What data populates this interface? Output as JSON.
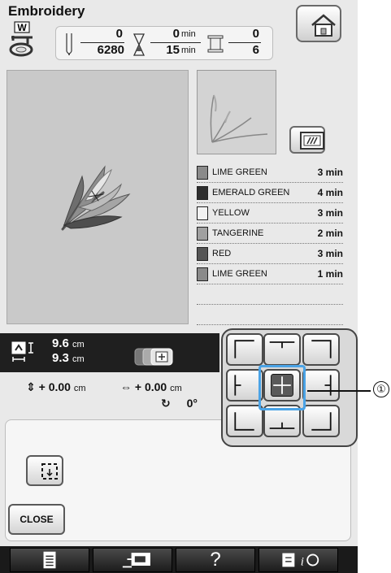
{
  "header": {
    "title": "Embroidery",
    "presser_foot_letter": "W",
    "stitch_current": "0",
    "stitch_total": "6280",
    "time_current": "0",
    "time_total": "15",
    "time_unit": "min",
    "color_current": "0",
    "color_total": "6"
  },
  "icons": {
    "home": "home-icon",
    "frame": "embroidery-frame-icon",
    "size": "size-icon",
    "multi_select": "multi-pattern-icon",
    "trial": "trial-frame-icon",
    "list": "list-icon",
    "sewing": "sewing-machine-icon",
    "help": "help-icon",
    "settings": "settings-icon"
  },
  "thread_colors": [
    {
      "name": "LIME GREEN",
      "time": "3 min",
      "color": "#8a8a8a"
    },
    {
      "name": "EMERALD GREEN",
      "time": "4 min",
      "color": "#2e2e2e"
    },
    {
      "name": "YELLOW",
      "time": "3 min",
      "color": "#f2f2f2"
    },
    {
      "name": "TANGERINE",
      "time": "2 min",
      "color": "#a0a0a0"
    },
    {
      "name": "RED",
      "time": "3 min",
      "color": "#555555"
    },
    {
      "name": "LIME GREEN",
      "time": "1 min",
      "color": "#8a8a8a"
    }
  ],
  "size": {
    "height": "9.6",
    "width": "9.3",
    "unit": "cm"
  },
  "position": {
    "vertical": "+ 0.00",
    "horizontal": "+ 0.00",
    "unit": "cm",
    "rotation": "0°"
  },
  "buttons": {
    "close": "CLOSE",
    "help": "?"
  },
  "callout": {
    "label": "①"
  },
  "colors": {
    "highlight": "#4aa3e6",
    "bar": "#1f1f1f"
  }
}
